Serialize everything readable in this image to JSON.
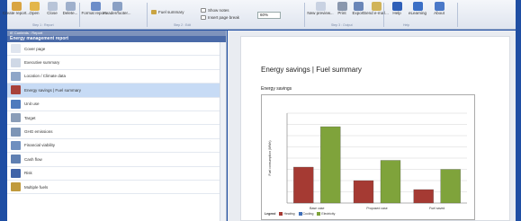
{
  "ribbon": {
    "buttons": [
      {
        "label": "Create report...",
        "icon": "create-icon",
        "color": "#d9a441"
      },
      {
        "label": "Open",
        "icon": "open-icon",
        "color": "#e3b64b"
      },
      {
        "label": "Close",
        "icon": "close-icon",
        "color": "#b8c4d8"
      },
      {
        "label": "Delete...",
        "icon": "delete-icon",
        "color": "#9fb0cc"
      },
      {
        "label": "Format report...",
        "icon": "format-icon",
        "color": "#6c8dc9"
      },
      {
        "label": "Header/footer...",
        "icon": "header-footer-icon",
        "color": "#8aa0c4"
      },
      {
        "label": "New preview...",
        "icon": "preview-icon",
        "color": "#c9d2e2"
      },
      {
        "label": "Print",
        "icon": "print-icon",
        "color": "#8a97ad"
      },
      {
        "label": "Export",
        "icon": "export-icon",
        "color": "#6a86b8"
      },
      {
        "label": "Send e-mail...",
        "icon": "email-icon",
        "color": "#d1b45a"
      },
      {
        "label": "Help",
        "icon": "help-icon",
        "color": "#2f5fb8"
      },
      {
        "label": "eLearning",
        "icon": "elearning-icon",
        "color": "#3b6fc6"
      },
      {
        "label": "About",
        "icon": "about-icon",
        "color": "#4a78c8"
      }
    ],
    "fuel_summary": "Fuel summary",
    "show_notes": "Show notes",
    "insert_page_break": "Insert page break",
    "zoom": "60%",
    "groups": [
      "Step 1 : Report",
      "Step 2 : Edit",
      "Step 3 : Output",
      "Help"
    ]
  },
  "left": {
    "header": "IE Contents : Report",
    "title": "Energy management report",
    "items": [
      {
        "label": "Cover page",
        "color": "#dfe5ef",
        "selected": false
      },
      {
        "label": "Executive summary",
        "color": "#cfd8e6",
        "selected": false
      },
      {
        "label": "Location / Climate data",
        "color": "#8fa6c8",
        "selected": false
      },
      {
        "label": "Energy savings | Fuel summary",
        "color": "#a8413a",
        "selected": true
      },
      {
        "label": "Unit use",
        "color": "#4f7bbd",
        "selected": false
      },
      {
        "label": "Target",
        "color": "#8a9db8",
        "selected": false
      },
      {
        "label": "GHG emissions",
        "color": "#7d95b6",
        "selected": false
      },
      {
        "label": "Financial viability",
        "color": "#6f8fbf",
        "selected": false
      },
      {
        "label": "Cash flow",
        "color": "#5e7fb2",
        "selected": false
      },
      {
        "label": "Risk",
        "color": "#3f63a8",
        "selected": false
      },
      {
        "label": "Multiple fuels",
        "color": "#c09a3c",
        "selected": false
      }
    ]
  },
  "page": {
    "title": "Energy savings | Fuel summary",
    "subtitle": "Energy savings"
  },
  "chart_data": {
    "type": "bar",
    "title": "",
    "ylabel": "Fuel consumption (MWh)",
    "xlabel": "",
    "categories": [
      "Base case",
      "Proposed case",
      "Fuel saved"
    ],
    "series": [
      {
        "name": "Heating",
        "color": "#a53a33",
        "values": [
          32,
          20,
          12
        ]
      },
      {
        "name": "Cooling",
        "color": "#3f6fb8",
        "values": [
          0,
          0,
          0
        ]
      },
      {
        "name": "Electricity",
        "color": "#7fa33b",
        "values": [
          68,
          38,
          30
        ]
      }
    ],
    "ylim": [
      0,
      80
    ],
    "grid": true,
    "legend_title": "Legend",
    "legend_position": "bottom-left"
  }
}
